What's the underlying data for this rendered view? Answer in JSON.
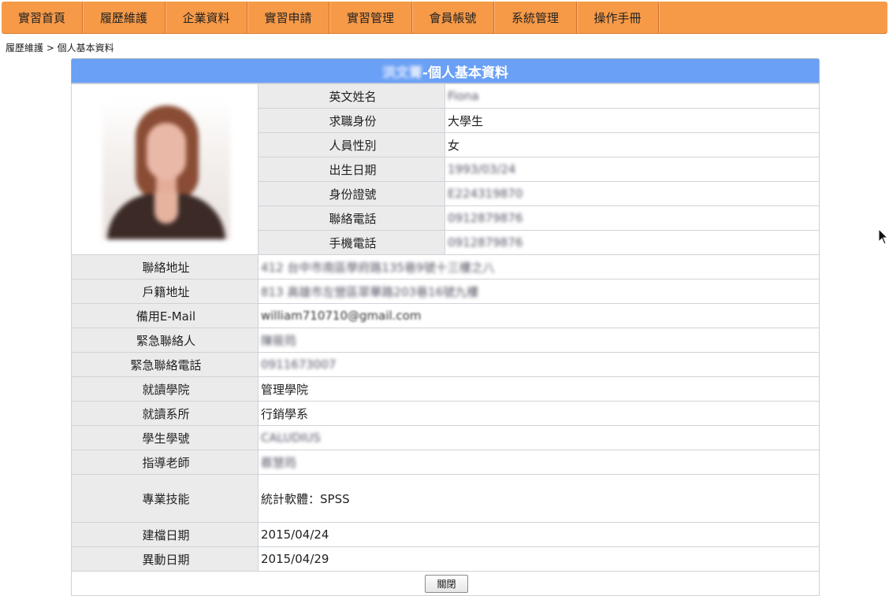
{
  "nav": {
    "items": [
      "實習首頁",
      "履歷維護",
      "企業資料",
      "實習申請",
      "實習管理",
      "會員帳號",
      "系統管理",
      "操作手冊"
    ]
  },
  "breadcrumb": "履歷維護 > 個人基本資料",
  "header": {
    "name": "洪文菁",
    "title": "-個人基本資料"
  },
  "fields": {
    "english_name": {
      "label": "英文姓名",
      "value": "Fiona"
    },
    "job_status": {
      "label": "求職身份",
      "value": "大學生"
    },
    "gender": {
      "label": "人員性別",
      "value": "女"
    },
    "birth_date": {
      "label": "出生日期",
      "value": "1993/03/24"
    },
    "id_number": {
      "label": "身份證號",
      "value": "E224319870"
    },
    "contact_phone": {
      "label": "聯絡電話",
      "value": "0912879876"
    },
    "mobile_phone": {
      "label": "手機電話",
      "value": "0912879876"
    },
    "contact_address": {
      "label": "聯絡地址",
      "value": "412 台中市南區學府路135巷9號十三樓之八"
    },
    "registered_address": {
      "label": "戶籍地址",
      "value": "813 高雄市左營區翠華路203巷16號九樓"
    },
    "backup_email": {
      "label": "備用E-Mail",
      "value": "william710710@gmail.com"
    },
    "emergency_contact": {
      "label": "緊急聯絡人",
      "value": "陳筱筠"
    },
    "emergency_phone": {
      "label": "緊急聯絡電話",
      "value": "0911673007"
    },
    "college": {
      "label": "就讀學院",
      "value": "管理學院"
    },
    "department": {
      "label": "就讀系所",
      "value": "行銷學系"
    },
    "student_id": {
      "label": "學生學號",
      "value": "CALUDIUS"
    },
    "advisor": {
      "label": "指導老師",
      "value": "蔡慧筠"
    },
    "skills": {
      "label": "專業技能",
      "value": "統計軟體：SPSS"
    },
    "created_date": {
      "label": "建檔日期",
      "value": "2015/04/24"
    },
    "modified_date": {
      "label": "異動日期",
      "value": "2015/04/29"
    }
  },
  "buttons": {
    "close": "關閉"
  },
  "colors": {
    "nav_bg": "#f79a48",
    "header_bg": "#6aa0f5",
    "label_bg": "#ebebeb"
  }
}
